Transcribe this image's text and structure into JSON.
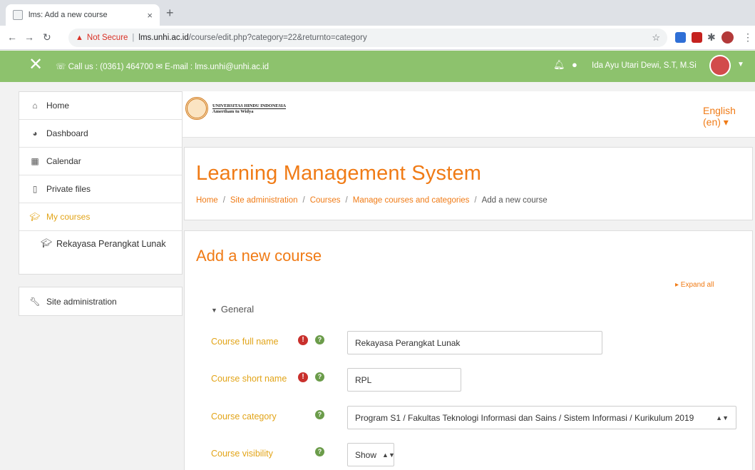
{
  "browser": {
    "tab_title": "lms: Add a new course",
    "tab_close": "×",
    "new_tab": "+",
    "not_secure": "Not Secure",
    "url_host": "lms.unhi.ac.id",
    "url_path": "/course/edit.php?category=22&returnto=category"
  },
  "navbar": {
    "contact": "☏ Call us : (0361) 464700 ✉ E-mail : lms.unhi@unhi.ac.id",
    "user_name": "Ida Ayu Utari Dewi, S.T, M.Si"
  },
  "sidebar": {
    "items": [
      {
        "label": "Home",
        "icon": "home-icon"
      },
      {
        "label": "Dashboard",
        "icon": "dashboard-icon"
      },
      {
        "label": "Calendar",
        "icon": "calendar-icon"
      },
      {
        "label": "Private files",
        "icon": "file-icon"
      },
      {
        "label": "My courses",
        "icon": "graduation-cap-icon"
      }
    ],
    "course": "Rekayasa Perangkat Lunak",
    "admin": "Site administration"
  },
  "header": {
    "logo_line1": "UNIVERSITAS HINDU INDONESIA",
    "logo_line2": "Amertham tu Widya",
    "language": "English (en) ▾"
  },
  "page": {
    "title": "Learning Management System",
    "breadcrumb": [
      "Home",
      "Site administration",
      "Courses",
      "Manage courses and categories",
      "Add a new course"
    ]
  },
  "form": {
    "heading": "Add a new course",
    "expand_all": "▸ Expand all",
    "section": "General",
    "fields": [
      {
        "label": "Course full name",
        "value": "Rekayasa Perangkat Lunak",
        "required": true
      },
      {
        "label": "Course short name",
        "value": "RPL",
        "required": true
      },
      {
        "label": "Course category",
        "value": "Program S1 / Fakultas Teknologi Informasi dan Sains / Sistem Informasi / Kurikulum 2019",
        "required": false
      },
      {
        "label": "Course visibility",
        "value": "Show",
        "required": false
      }
    ]
  },
  "colors": {
    "accent": "#f07b16",
    "label": "#e2a418",
    "navbar": "#8dc26d"
  }
}
